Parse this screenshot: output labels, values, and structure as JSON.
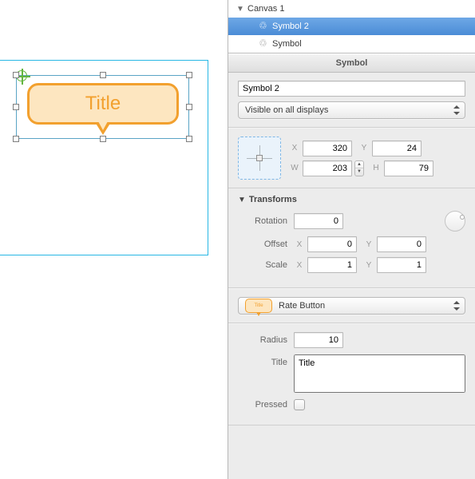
{
  "outline": {
    "canvas_label": "Canvas 1",
    "items": [
      {
        "label": "Symbol 2",
        "selected": true
      },
      {
        "label": "Symbol",
        "selected": false
      }
    ]
  },
  "section_title": "Symbol",
  "name_field": "Symbol 2",
  "visibility": "Visible on all displays",
  "geometry": {
    "x_label": "X",
    "x": "320",
    "y_label": "Y",
    "y": "24",
    "w_label": "W",
    "w": "203",
    "h_label": "H",
    "h": "79"
  },
  "transforms": {
    "title": "Transforms",
    "rotation_label": "Rotation",
    "rotation": "0",
    "offset_label": "Offset",
    "offset_x_label": "X",
    "offset_x": "0",
    "offset_y_label": "Y",
    "offset_y": "0",
    "scale_label": "Scale",
    "scale_x_label": "X",
    "scale_x": "1",
    "scale_y_label": "Y",
    "scale_y": "1"
  },
  "component": {
    "name": "Rate Button",
    "radius_label": "Radius",
    "radius": "10",
    "title_label": "Title",
    "title": "Title",
    "pressed_label": "Pressed",
    "pressed": false
  },
  "canvas": {
    "shape_text": "Title"
  }
}
